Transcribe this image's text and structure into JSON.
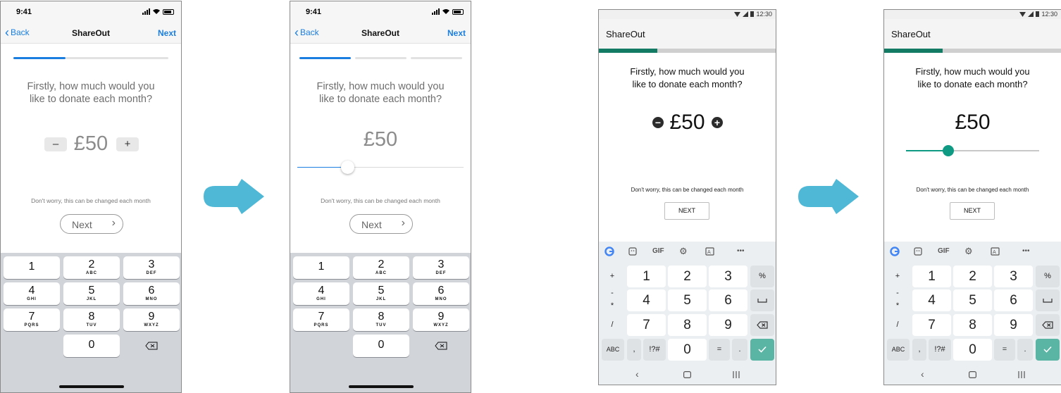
{
  "ios_common": {
    "time": "9:41",
    "back_label": "Back",
    "title": "ShareOut",
    "next_label": "Next",
    "question_line1": "Firstly, how much would you",
    "question_line2": "like to donate each month?",
    "amount": "£50",
    "minus": "–",
    "plus": "+",
    "note": "Don't worry, this can be changed each month",
    "next_button": "Next",
    "keys": [
      {
        "digit": "1",
        "letters": ""
      },
      {
        "digit": "2",
        "letters": "ABC"
      },
      {
        "digit": "3",
        "letters": "DEF"
      },
      {
        "digit": "4",
        "letters": "GHI"
      },
      {
        "digit": "5",
        "letters": "JKL"
      },
      {
        "digit": "6",
        "letters": "MNO"
      },
      {
        "digit": "7",
        "letters": "PQRS"
      },
      {
        "digit": "8",
        "letters": "TUV"
      },
      {
        "digit": "9",
        "letters": "WXYZ"
      },
      {
        "digit": "0",
        "letters": ""
      }
    ],
    "slider_value_fraction": 0.3
  },
  "android_common": {
    "time": "12:30",
    "title": "ShareOut",
    "progress_fraction": 0.33,
    "question_line1": "Firstly, how much would you",
    "question_line2": "like to donate each month?",
    "amount": "£50",
    "minus": "−",
    "plus": "+",
    "note": "Don't worry, this can be changed each month",
    "next_button": "NEXT",
    "toolbar": {
      "gif": "GIF",
      "more": "•••"
    },
    "left_col": [
      "+",
      "-",
      "*",
      "/"
    ],
    "digits": [
      "1",
      "2",
      "3",
      "4",
      "5",
      "6",
      "7",
      "8",
      "9",
      "0"
    ],
    "right_col": {
      "percent": "%"
    },
    "bottom": {
      "abc": "ABC",
      "comma": ",",
      "symbols": "!?#",
      "equals": "=",
      "period": "."
    },
    "slider_value_fraction": 0.32
  },
  "colors": {
    "ios_accent": "#1a7ee0",
    "android_accent": "#137a63",
    "android_slider": "#0f9a84",
    "arrow": "#4fb8d6"
  }
}
